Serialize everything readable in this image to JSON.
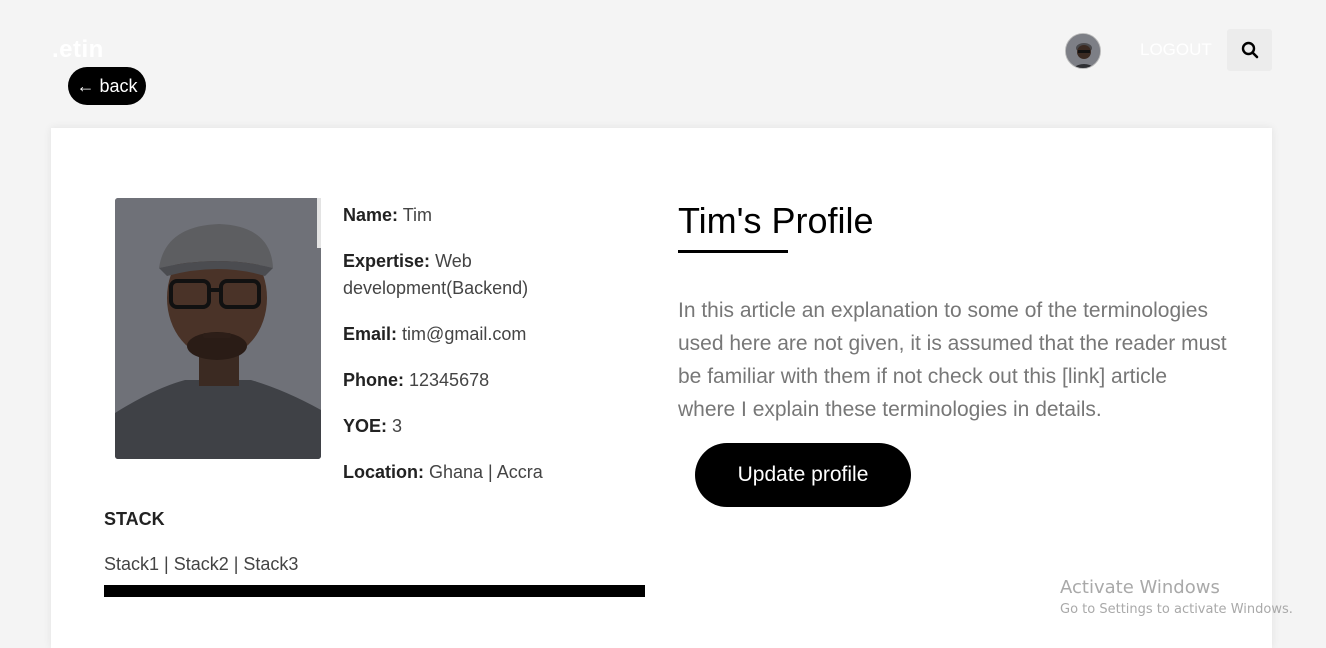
{
  "header": {
    "logo": ".etin",
    "back_label": "← back",
    "logout_label": "LOGOUT"
  },
  "profile": {
    "fields": [
      {
        "label": "Name:",
        "value": "Tim"
      },
      {
        "label": "Expertise:",
        "value": "Web development(Backend)"
      },
      {
        "label": "Email:",
        "value": "tim@gmail.com"
      },
      {
        "label": "Phone:",
        "value": "12345678"
      },
      {
        "label": "YOE:",
        "value": "3"
      },
      {
        "label": "Location:",
        "value": "Ghana | Accra"
      }
    ],
    "stack_title": "STACK",
    "stack_list": "Stack1 | Stack2 | Stack3",
    "title": "Tim's Profile",
    "description": "In this article an explanation to some of the terminologies used here are not given, it is assumed that the reader must be familiar with them if not check out this [link] article where I explain these terminologies in details.",
    "update_label": "Update profile"
  },
  "watermark": {
    "line1": "Activate Windows",
    "line2": "Go to Settings to activate Windows."
  },
  "icons": {
    "search": "search-icon"
  }
}
